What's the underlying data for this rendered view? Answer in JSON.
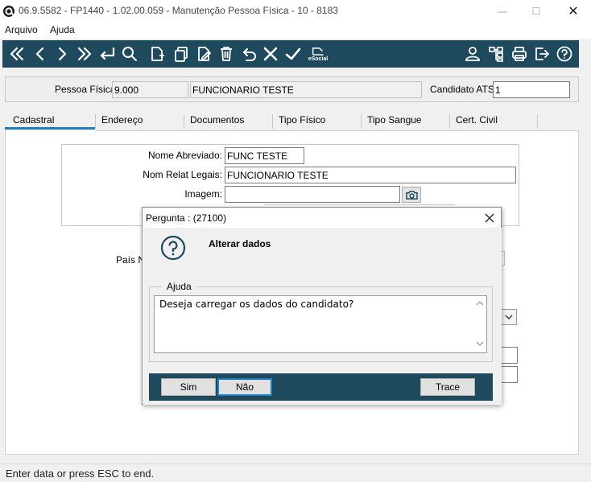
{
  "window": {
    "title": "06.9.5582 - FP1440 - 1.02.00.059 - Manutenção Pessoa Física - 10 - 8183",
    "minimize_glyph": "—",
    "maximize_glyph": "☐",
    "close_glyph": "✕"
  },
  "menu": {
    "arquivo": "Arquivo",
    "ajuda": "Ajuda"
  },
  "toolbar": {
    "icons": [
      "first-record-icon",
      "previous-record-icon",
      "next-record-icon",
      "last-record-icon",
      "go-to-icon",
      "search-icon",
      "new-record-icon",
      "copy-record-icon",
      "edit-record-icon",
      "delete-record-icon",
      "undo-icon",
      "cancel-icon",
      "confirm-icon",
      "esocial-icon",
      "user-icon",
      "tree-icon",
      "print-icon",
      "exit-icon",
      "help-icon"
    ],
    "esocial_label": "eSocial"
  },
  "header": {
    "pessoa_fisica_label": "Pessoa Física:",
    "pessoa_fisica_code": "9.000",
    "pessoa_fisica_name": "FUNCIONARIO TESTE",
    "candidato_label": "Candidato ATS:",
    "candidato_value": "1"
  },
  "tabs": [
    "Cadastral",
    "Endereço",
    "Documentos",
    "Tipo Físico",
    "Tipo Sangue",
    "Cert. Civil"
  ],
  "form": {
    "nome_abreviado_label": "Nome Abreviado:",
    "nome_abreviado_value": "FUNC TESTE",
    "nom_relat_label": "Nom Relat Legais:",
    "nom_relat_value": "FUNCIONARIO TESTE",
    "imagem_label": "Imagem:",
    "imagem_value": "",
    "pais_label": "País Na"
  },
  "dialog": {
    "title": "Pergunta : (27100)",
    "heading": "Alterar dados",
    "group_label": "Ajuda",
    "message": "Deseja carregar os dados do candidato?",
    "buttons": {
      "sim": "Sim",
      "nao": "Não",
      "trace": "Trace"
    }
  },
  "status": {
    "text": "Enter data or press ESC to end."
  },
  "colors": {
    "toolbar_bg": "#1f4a5e",
    "tab_accent": "#1f7cc1",
    "focus_border": "#1f7cc1"
  }
}
